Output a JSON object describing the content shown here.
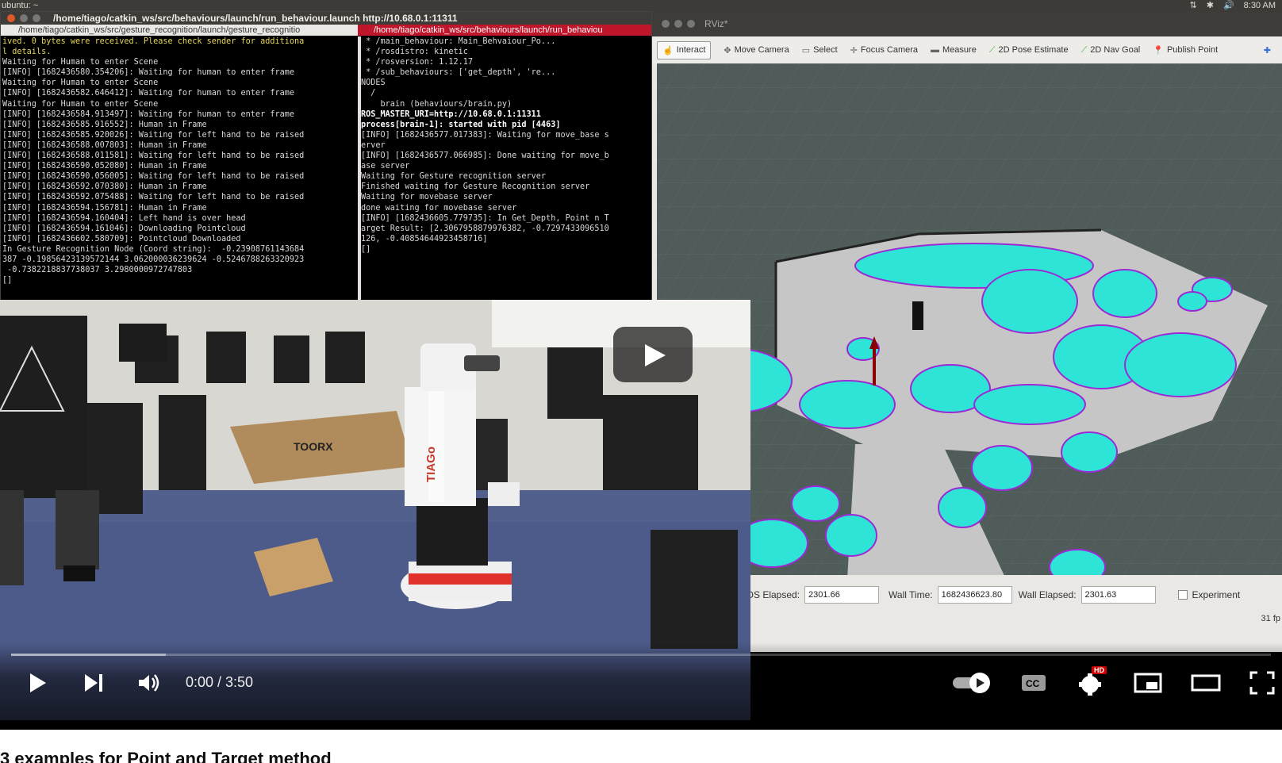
{
  "os_bar": {
    "title": "ubuntu: ~",
    "time": "8:30 AM"
  },
  "terminal": {
    "title": "/home/tiago/catkin_ws/src/behaviours/launch/run_behaviour.launch http://10.68.0.1:11311",
    "tab1": "/home/tiago/catkin_ws/src/gesture_recognition/launch/gesture_recognitio",
    "tab2": "/home/tiago/catkin_ws/src/behaviours/launch/run_behaviou",
    "pane1_lines": [
      "ived. 0 bytes were received. Please check sender for additiona",
      "l details.",
      "Waiting for Human to enter Scene",
      "[INFO] [1682436580.354206]: Waiting for human to enter frame",
      "Waiting for Human to enter Scene",
      "[INFO] [1682436582.646412]: Waiting for human to enter frame",
      "Waiting for Human to enter Scene",
      "[INFO] [1682436584.913497]: Waiting for human to enter frame",
      "[INFO] [1682436585.916552]: Human in Frame",
      "[INFO] [1682436585.920026]: Waiting for left hand to be raised",
      "[INFO] [1682436588.007803]: Human in Frame",
      "[INFO] [1682436588.011581]: Waiting for left hand to be raised",
      "[INFO] [1682436590.052080]: Human in Frame",
      "[INFO] [1682436590.056005]: Waiting for left hand to be raised",
      "[INFO] [1682436592.070380]: Human in Frame",
      "[INFO] [1682436592.075488]: Waiting for left hand to be raised",
      "[INFO] [1682436594.156781]: Human in Frame",
      "[INFO] [1682436594.160404]: Left hand is over head",
      "[INFO] [1682436594.161046]: Downloading Pointcloud",
      "[INFO] [1682436602.580709]: Pointcloud Downloaded",
      "In Gesture Recognition Node (Coord string):  -0.23908761143684",
      "387 -0.19856423139572144 3.062000036239624 -0.5246788263320923",
      " -0.7382218837738037 3.2980000972747803",
      "[]"
    ],
    "pane2_lines": [
      " * /main_behaviour: Main_Behvaiour_Po...",
      " * /rosdistro: kinetic",
      " * /rosversion: 1.12.17",
      " * /sub_behaviours: ['get_depth', 're...",
      "",
      "NODES",
      "  /",
      "    brain (behaviours/brain.py)",
      "",
      "ROS_MASTER_URI=http://10.68.0.1:11311",
      "",
      "process[brain-1]: started with pid [4463]",
      "[INFO] [1682436577.017383]: Waiting for move_base s",
      "erver",
      "[INFO] [1682436577.066985]: Done waiting for move_b",
      "ase server",
      "Waiting for Gesture recognition server",
      "Finished waiting for Gesture Recognition server",
      "Waiting for movebase server",
      "done waiting for movebase server",
      "[INFO] [1682436605.779735]: In Get_Depth, Point n T",
      "arget Result: [2.3067958879976382, -0.7297433096510",
      "126, -0.408546449234587​16]",
      "[]"
    ]
  },
  "rviz": {
    "title": "RViz*",
    "tools": [
      {
        "label": "Interact",
        "icon": "hand-icon"
      },
      {
        "label": "Move Camera",
        "icon": "move-icon"
      },
      {
        "label": "Select",
        "icon": "select-icon"
      },
      {
        "label": "Focus Camera",
        "icon": "focus-icon"
      },
      {
        "label": "Measure",
        "icon": "ruler-icon"
      },
      {
        "label": "2D Pose Estimate",
        "icon": "arrow-green-icon"
      },
      {
        "label": "2D Nav Goal",
        "icon": "arrow-green-icon"
      },
      {
        "label": "Publish Point",
        "icon": "pin-icon"
      }
    ],
    "ros_elapsed_label": "ROS Elapsed:",
    "ros_elapsed": "2301.66",
    "wall_time_label": "Wall Time:",
    "wall_time": "1682436623.80",
    "wall_elapsed_label": "Wall Elapsed:",
    "wall_elapsed": "2301.63",
    "experimental_label": "Experiment",
    "fps": "31 fp"
  },
  "camera": {
    "box_brand": "TOORX",
    "robot_brand": "TIAGo"
  },
  "player": {
    "time": "0:00 / 3:50",
    "hd_badge": "HD",
    "buffered_fraction": 0.123,
    "accent": "#ff0000"
  },
  "caption": "3 examples for Point and Target method"
}
